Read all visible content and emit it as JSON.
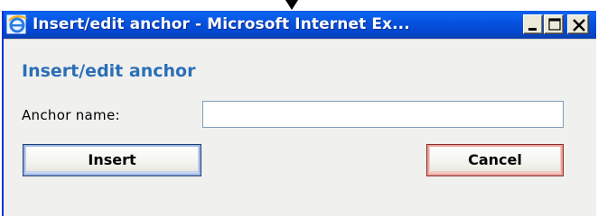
{
  "window": {
    "title": "Insert/edit anchor - Microsoft Internet Ex...",
    "icon": "internet-explorer-icon",
    "controls": [
      "minimize-icon",
      "maximize-icon",
      "close-icon"
    ]
  },
  "dialog": {
    "heading": "Insert/edit anchor",
    "field_label": "Anchor name:",
    "field_value": "",
    "insert_label": "Insert",
    "cancel_label": "Cancel"
  },
  "colors": {
    "titlebar": "#0550dc",
    "heading": "#2b6fb6",
    "insert_border": "#1f3f73",
    "cancel_border": "#8a2b2b"
  }
}
